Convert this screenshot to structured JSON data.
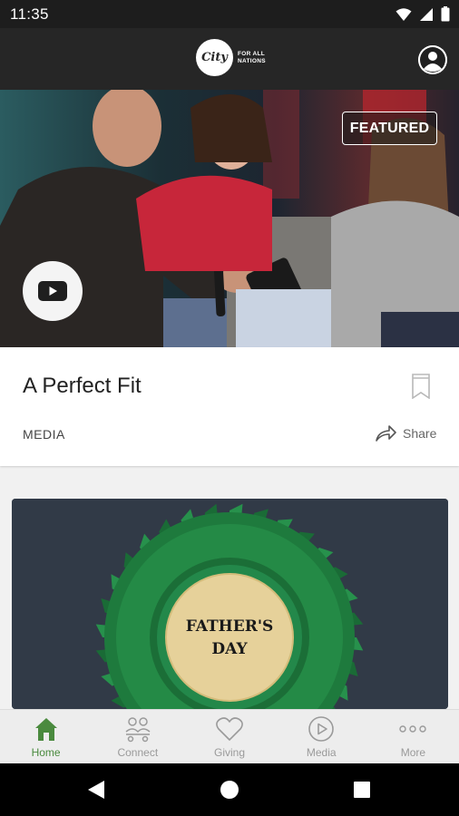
{
  "status_bar": {
    "time": "11:35"
  },
  "app_bar": {
    "logo_script": "City",
    "logo_tagline": "FOR ALL NATIONS"
  },
  "hero": {
    "badge": "FEATURED"
  },
  "featured_card": {
    "title": "A Perfect Fit",
    "type": "MEDIA",
    "share_label": "Share"
  },
  "second_card": {
    "rosette_text_line1": "FATHER'S",
    "rosette_text_line2": "DAY"
  },
  "bottom_nav": {
    "items": [
      {
        "label": "Home",
        "icon": "home-icon",
        "active": true
      },
      {
        "label": "Connect",
        "icon": "connect-icon",
        "active": false
      },
      {
        "label": "Giving",
        "icon": "heart-icon",
        "active": false
      },
      {
        "label": "Media",
        "icon": "play-circle-icon",
        "active": false
      },
      {
        "label": "More",
        "icon": "more-icon",
        "active": false
      }
    ]
  },
  "colors": {
    "accent": "#4a8a3e",
    "app_bar": "#262626",
    "rosette_green": "#1f7a3e",
    "rosette_gold": "#e8d29a"
  }
}
